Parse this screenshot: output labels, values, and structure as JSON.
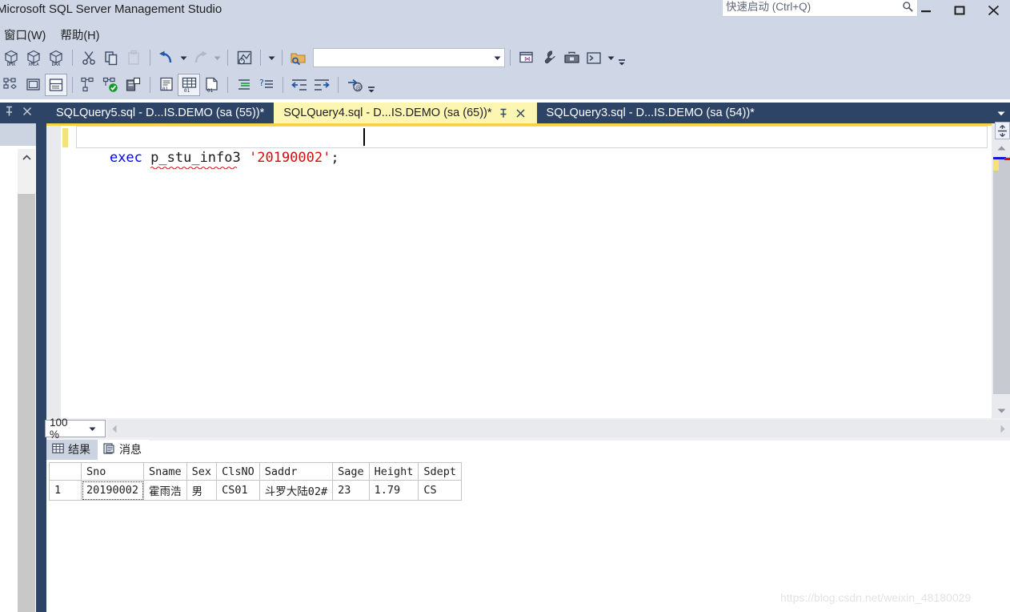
{
  "window": {
    "title": "Microsoft SQL Server Management Studio",
    "minimize_label": "minimize",
    "maximize_label": "maximize",
    "close_label": "close"
  },
  "quick_launch": {
    "placeholder": "快速启动 (Ctrl+Q)",
    "value": "",
    "icon": "search-icon"
  },
  "menu": {
    "items": [
      {
        "label": "窗口(W)"
      },
      {
        "label": "帮助(H)"
      }
    ]
  },
  "toolbar_row1": {
    "buttons": [
      {
        "name": "new-dmx-query-button",
        "icon": "dmx-query-icon",
        "label": "DMX"
      },
      {
        "name": "new-xmla-query-button",
        "icon": "xmla-query-icon",
        "label": "XMLA"
      },
      {
        "name": "new-dax-query-button",
        "icon": "dax-query-icon",
        "label": "DAX"
      },
      {
        "name": "cut-button",
        "icon": "scissors-icon",
        "label": "剪切"
      },
      {
        "name": "copy-button",
        "icon": "copy-icon",
        "label": "复制"
      },
      {
        "name": "paste-button",
        "icon": "paste-icon",
        "label": "粘贴"
      },
      {
        "name": "undo-button",
        "icon": "undo-arrow-icon",
        "label": "撤消"
      },
      {
        "name": "redo-button",
        "icon": "redo-arrow-icon",
        "label": "恢复"
      },
      {
        "name": "summary-window-button",
        "icon": "summary-icon",
        "label": "摘要"
      },
      {
        "name": "open-file-button",
        "icon": "folder-search-icon",
        "label": "打开"
      },
      {
        "name": "window-layout-button",
        "icon": "window-icon",
        "label": "窗口"
      },
      {
        "name": "properties-button",
        "icon": "wrench-icon",
        "label": "属性"
      },
      {
        "name": "toolbox-button",
        "icon": "toolbox-icon",
        "label": "工具箱"
      },
      {
        "name": "command-prompt-button",
        "icon": "console-icon",
        "label": "命令提示符"
      }
    ],
    "combo_value": "",
    "combo_placeholder": ""
  },
  "toolbar_row2": {
    "buttons": [
      {
        "name": "object-explorer-button",
        "icon": "object-explorer-icon",
        "label": "对象资源管理器"
      },
      {
        "name": "registered-servers-button",
        "icon": "registered-servers-icon",
        "label": "已注册的服务器"
      },
      {
        "name": "template-explorer-button",
        "icon": "template-explorer-icon",
        "label": "模板资源管理器"
      },
      {
        "name": "parse-query-button",
        "icon": "parse-icon",
        "label": "分析"
      },
      {
        "name": "execute-query-button",
        "icon": "execute-check-icon",
        "label": "执行"
      },
      {
        "name": "include-actual-plan-button",
        "icon": "execution-plan-icon",
        "label": "包括实际的执行计划"
      },
      {
        "name": "results-to-text-button",
        "icon": "results-to-text-icon",
        "label": "以文本格式显示结果"
      },
      {
        "name": "results-to-grid-button",
        "icon": "results-to-grid-icon",
        "label": "以网格显示结果"
      },
      {
        "name": "results-to-file-button",
        "icon": "results-to-file-icon",
        "label": "将结果保存到文件"
      },
      {
        "name": "comment-lines-button",
        "icon": "comment-icon",
        "label": "注释选中行"
      },
      {
        "name": "uncomment-lines-button",
        "icon": "uncomment-icon",
        "label": "取消注释选中行"
      },
      {
        "name": "decrease-indent-button",
        "icon": "decrease-indent-icon",
        "label": "减少缩进"
      },
      {
        "name": "increase-indent-button",
        "icon": "increase-indent-icon",
        "label": "增加缩进"
      },
      {
        "name": "specify-values-button",
        "icon": "specify-values-icon",
        "label": "为模板参数赋值"
      }
    ]
  },
  "dock_panel": {
    "pin_label": "自动隐藏",
    "close_label": "关闭"
  },
  "tabs": [
    {
      "label": "SQLQuery5.sql - D...IS.DEMO (sa (55))*",
      "active": false
    },
    {
      "label": "SQLQuery4.sql - D...IS.DEMO (sa (65))*",
      "active": true
    },
    {
      "label": "SQLQuery3.sql - D...IS.DEMO (sa (54))*",
      "active": false
    }
  ],
  "editor": {
    "code": {
      "keyword": "exec",
      "space1": " ",
      "identifier": "p_stu_info3",
      "space2": " ",
      "string": "'20190002'",
      "terminator": ";"
    },
    "colors": {
      "keyword": "#0000ff",
      "identifier": "#1a1a1a",
      "string": "#ce1010",
      "squiggle": "#d40000",
      "change_bar": "#f5e27a"
    }
  },
  "zoom": {
    "value": "100 %"
  },
  "result_tabs": [
    {
      "label": "结果",
      "icon": "grid-icon",
      "active": true
    },
    {
      "label": "消息",
      "icon": "message-icon",
      "active": false
    }
  ],
  "results_grid": {
    "columns": [
      "Sno",
      "Sname",
      "Sex",
      "ClsNO",
      "Saddr",
      "Sage",
      "Height",
      "Sdept"
    ],
    "rows": [
      {
        "row_number": "1",
        "cells": [
          "20190002",
          "霍雨浩",
          "男",
          "CS01",
          "斗罗大陆02#",
          "23",
          "1.79",
          "CS"
        ]
      }
    ],
    "selected_cell": {
      "row": 0,
      "column": 0
    }
  },
  "watermark": {
    "text": "https://blog.csdn.net/weixin_48180029"
  }
}
